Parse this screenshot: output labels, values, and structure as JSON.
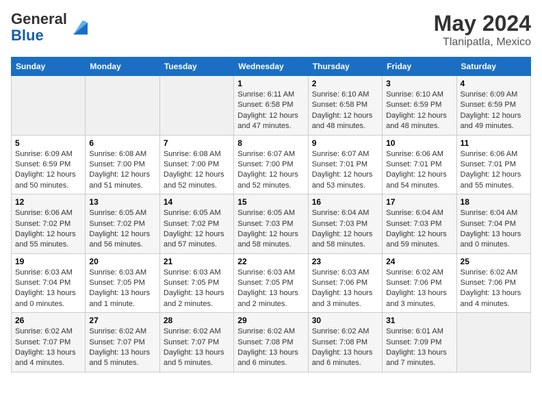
{
  "logo": {
    "general": "General",
    "blue": "Blue"
  },
  "header": {
    "month_year": "May 2024",
    "location": "Tlanipatla, Mexico"
  },
  "days_of_week": [
    "Sunday",
    "Monday",
    "Tuesday",
    "Wednesday",
    "Thursday",
    "Friday",
    "Saturday"
  ],
  "weeks": [
    [
      {
        "day": "",
        "info": ""
      },
      {
        "day": "",
        "info": ""
      },
      {
        "day": "",
        "info": ""
      },
      {
        "day": "1",
        "info": "Sunrise: 6:11 AM\nSunset: 6:58 PM\nDaylight: 12 hours and 47 minutes."
      },
      {
        "day": "2",
        "info": "Sunrise: 6:10 AM\nSunset: 6:58 PM\nDaylight: 12 hours and 48 minutes."
      },
      {
        "day": "3",
        "info": "Sunrise: 6:10 AM\nSunset: 6:59 PM\nDaylight: 12 hours and 48 minutes."
      },
      {
        "day": "4",
        "info": "Sunrise: 6:09 AM\nSunset: 6:59 PM\nDaylight: 12 hours and 49 minutes."
      }
    ],
    [
      {
        "day": "5",
        "info": "Sunrise: 6:09 AM\nSunset: 6:59 PM\nDaylight: 12 hours and 50 minutes."
      },
      {
        "day": "6",
        "info": "Sunrise: 6:08 AM\nSunset: 7:00 PM\nDaylight: 12 hours and 51 minutes."
      },
      {
        "day": "7",
        "info": "Sunrise: 6:08 AM\nSunset: 7:00 PM\nDaylight: 12 hours and 52 minutes."
      },
      {
        "day": "8",
        "info": "Sunrise: 6:07 AM\nSunset: 7:00 PM\nDaylight: 12 hours and 52 minutes."
      },
      {
        "day": "9",
        "info": "Sunrise: 6:07 AM\nSunset: 7:01 PM\nDaylight: 12 hours and 53 minutes."
      },
      {
        "day": "10",
        "info": "Sunrise: 6:06 AM\nSunset: 7:01 PM\nDaylight: 12 hours and 54 minutes."
      },
      {
        "day": "11",
        "info": "Sunrise: 6:06 AM\nSunset: 7:01 PM\nDaylight: 12 hours and 55 minutes."
      }
    ],
    [
      {
        "day": "12",
        "info": "Sunrise: 6:06 AM\nSunset: 7:02 PM\nDaylight: 12 hours and 55 minutes."
      },
      {
        "day": "13",
        "info": "Sunrise: 6:05 AM\nSunset: 7:02 PM\nDaylight: 12 hours and 56 minutes."
      },
      {
        "day": "14",
        "info": "Sunrise: 6:05 AM\nSunset: 7:02 PM\nDaylight: 12 hours and 57 minutes."
      },
      {
        "day": "15",
        "info": "Sunrise: 6:05 AM\nSunset: 7:03 PM\nDaylight: 12 hours and 58 minutes."
      },
      {
        "day": "16",
        "info": "Sunrise: 6:04 AM\nSunset: 7:03 PM\nDaylight: 12 hours and 58 minutes."
      },
      {
        "day": "17",
        "info": "Sunrise: 6:04 AM\nSunset: 7:03 PM\nDaylight: 12 hours and 59 minutes."
      },
      {
        "day": "18",
        "info": "Sunrise: 6:04 AM\nSunset: 7:04 PM\nDaylight: 13 hours and 0 minutes."
      }
    ],
    [
      {
        "day": "19",
        "info": "Sunrise: 6:03 AM\nSunset: 7:04 PM\nDaylight: 13 hours and 0 minutes."
      },
      {
        "day": "20",
        "info": "Sunrise: 6:03 AM\nSunset: 7:05 PM\nDaylight: 13 hours and 1 minute."
      },
      {
        "day": "21",
        "info": "Sunrise: 6:03 AM\nSunset: 7:05 PM\nDaylight: 13 hours and 2 minutes."
      },
      {
        "day": "22",
        "info": "Sunrise: 6:03 AM\nSunset: 7:05 PM\nDaylight: 13 hours and 2 minutes."
      },
      {
        "day": "23",
        "info": "Sunrise: 6:03 AM\nSunset: 7:06 PM\nDaylight: 13 hours and 3 minutes."
      },
      {
        "day": "24",
        "info": "Sunrise: 6:02 AM\nSunset: 7:06 PM\nDaylight: 13 hours and 3 minutes."
      },
      {
        "day": "25",
        "info": "Sunrise: 6:02 AM\nSunset: 7:06 PM\nDaylight: 13 hours and 4 minutes."
      }
    ],
    [
      {
        "day": "26",
        "info": "Sunrise: 6:02 AM\nSunset: 7:07 PM\nDaylight: 13 hours and 4 minutes."
      },
      {
        "day": "27",
        "info": "Sunrise: 6:02 AM\nSunset: 7:07 PM\nDaylight: 13 hours and 5 minutes."
      },
      {
        "day": "28",
        "info": "Sunrise: 6:02 AM\nSunset: 7:07 PM\nDaylight: 13 hours and 5 minutes."
      },
      {
        "day": "29",
        "info": "Sunrise: 6:02 AM\nSunset: 7:08 PM\nDaylight: 13 hours and 6 minutes."
      },
      {
        "day": "30",
        "info": "Sunrise: 6:02 AM\nSunset: 7:08 PM\nDaylight: 13 hours and 6 minutes."
      },
      {
        "day": "31",
        "info": "Sunrise: 6:01 AM\nSunset: 7:09 PM\nDaylight: 13 hours and 7 minutes."
      },
      {
        "day": "",
        "info": ""
      }
    ]
  ]
}
